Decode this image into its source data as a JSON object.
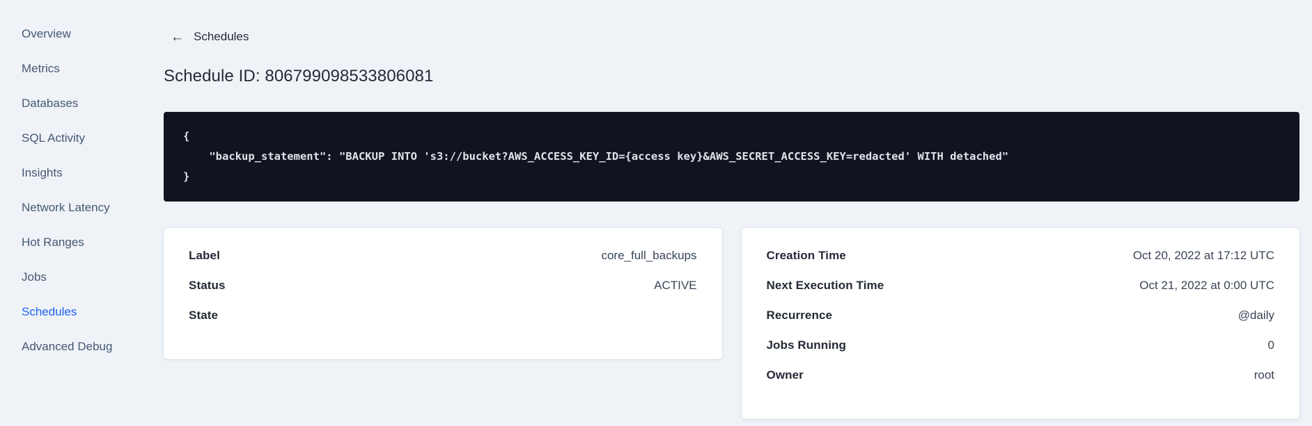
{
  "sidebar": {
    "items": [
      {
        "label": "Overview"
      },
      {
        "label": "Metrics"
      },
      {
        "label": "Databases"
      },
      {
        "label": "SQL Activity"
      },
      {
        "label": "Insights"
      },
      {
        "label": "Network Latency"
      },
      {
        "label": "Hot Ranges"
      },
      {
        "label": "Jobs"
      },
      {
        "label": "Schedules",
        "active": true
      },
      {
        "label": "Advanced Debug"
      }
    ]
  },
  "header": {
    "back_icon": "←",
    "back_label": "Schedules",
    "title": "Schedule ID: 806799098533806081"
  },
  "code": {
    "lines": [
      "{",
      "    \"backup_statement\": \"BACKUP INTO 's3://bucket?AWS_ACCESS_KEY_ID={access key}&AWS_SECRET_ACCESS_KEY=redacted' WITH detached\"",
      "}"
    ]
  },
  "schedule_details": {
    "left_card": {
      "rows": [
        {
          "label": "Label",
          "value": "core_full_backups"
        },
        {
          "label": "Status",
          "value": "ACTIVE"
        },
        {
          "label": "State",
          "value": ""
        }
      ]
    },
    "right_card": {
      "rows": [
        {
          "label": "Creation Time",
          "value": "Oct 20, 2022 at 17:12 UTC"
        },
        {
          "label": "Next Execution Time",
          "value": "Oct 21, 2022 at 0:00 UTC"
        },
        {
          "label": "Recurrence",
          "value": "@daily"
        },
        {
          "label": "Jobs Running",
          "value": "0"
        },
        {
          "label": "Owner",
          "value": "root"
        }
      ]
    }
  },
  "colors": {
    "page_background": "#eff3f8",
    "accent_active_link": "#2061f2",
    "sidebar_text": "#475872",
    "heading_text": "#242a35",
    "code_background": "#10141f",
    "code_text": "#dfe3eb",
    "card_background": "#ffffff"
  }
}
